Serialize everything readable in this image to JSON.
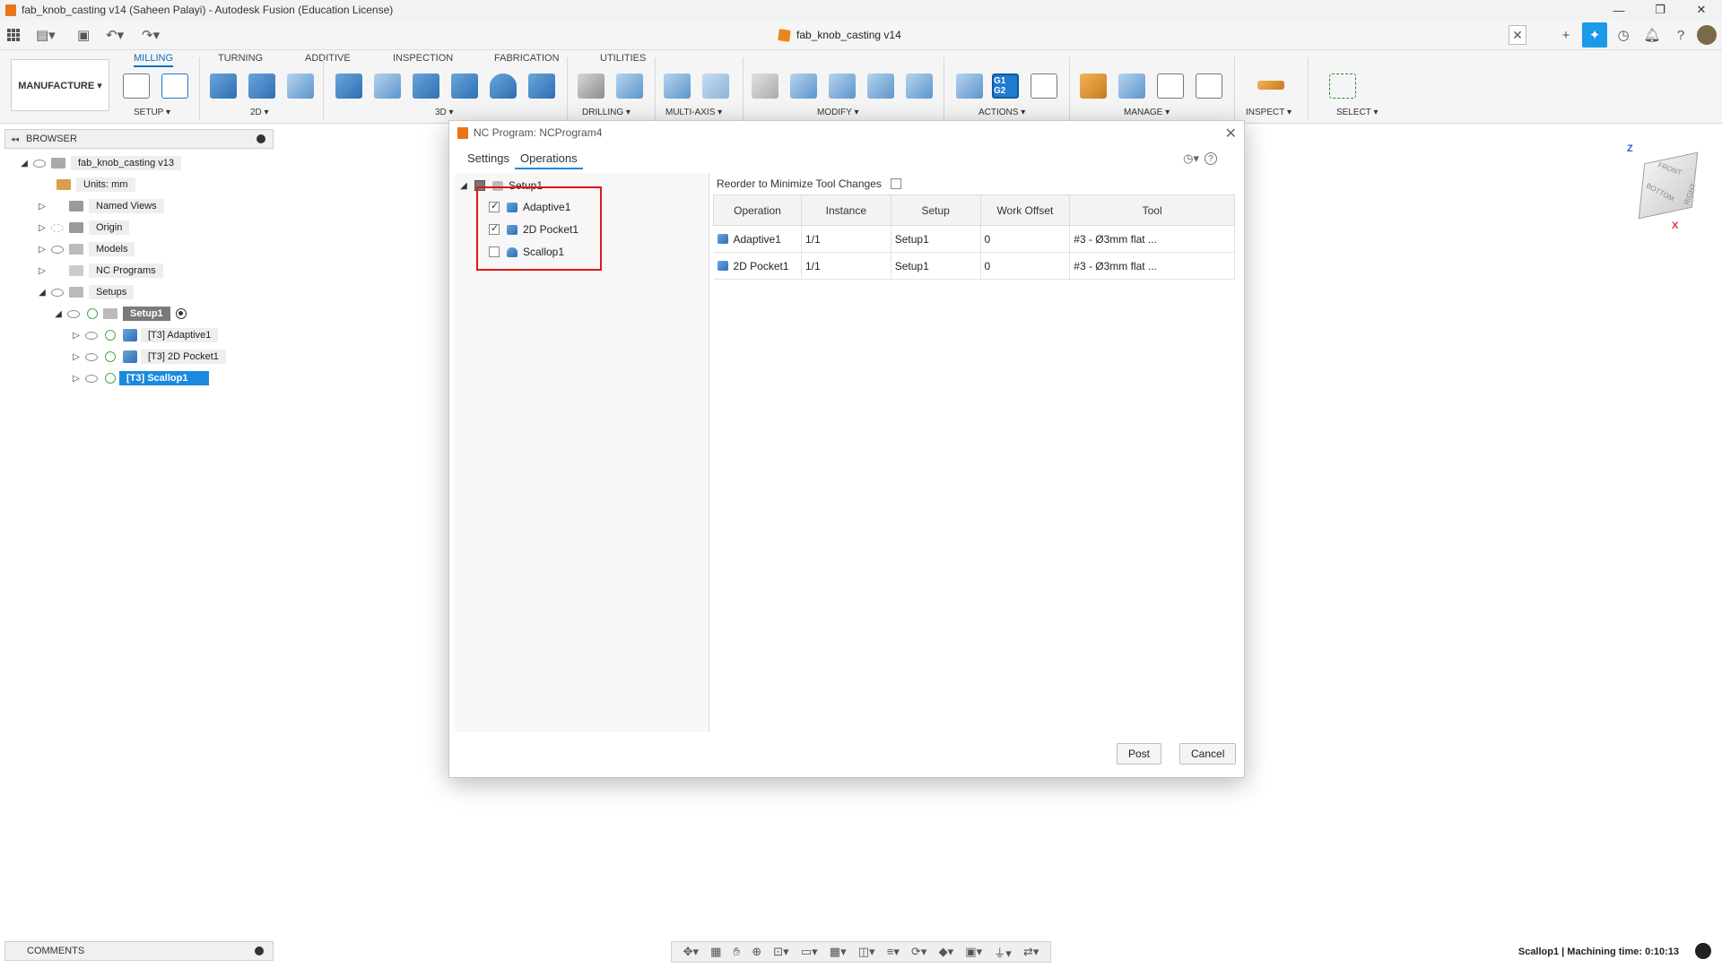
{
  "window": {
    "title": "fab_knob_casting v14 (Saheen Palayi) - Autodesk Fusion (Education License)",
    "minimize": "—",
    "restore": "❐",
    "close": "✕"
  },
  "document_tab": {
    "label": "fab_knob_casting v14",
    "close": "✕"
  },
  "workspace": {
    "label": "MANUFACTURE ▾"
  },
  "ribbon": {
    "tabs": [
      "MILLING",
      "TURNING",
      "ADDITIVE",
      "INSPECTION",
      "FABRICATION",
      "UTILITIES"
    ],
    "groups": [
      "SETUP ▾",
      "2D ▾",
      "3D ▾",
      "DRILLING ▾",
      "MULTI-AXIS ▾",
      "MODIFY ▾",
      "ACTIONS ▾",
      "MANAGE ▾",
      "INSPECT ▾",
      "SELECT ▾"
    ],
    "g1g2": "G1 G2"
  },
  "browser": {
    "header": "BROWSER",
    "root": "fab_knob_casting v13",
    "units": "Units: mm",
    "items": [
      "Named Views",
      "Origin",
      "Models",
      "NC Programs",
      "Setups"
    ],
    "setup": "Setup1",
    "operations": [
      "[T3] Adaptive1",
      "[T3] 2D Pocket1",
      "[T3] Scallop1"
    ]
  },
  "dialog": {
    "title": "NC Program: NCProgram4",
    "tabs": [
      "Settings",
      "Operations"
    ],
    "tree": {
      "setup": "Setup1",
      "ops": [
        {
          "label": "Adaptive1",
          "checked": true
        },
        {
          "label": "2D Pocket1",
          "checked": true
        },
        {
          "label": "Scallop1",
          "checked": false
        }
      ]
    },
    "reorder_label": "Reorder to Minimize Tool Changes",
    "table": {
      "headers": [
        "Operation",
        "Instance",
        "Setup",
        "Work Offset",
        "Tool"
      ],
      "rows": [
        {
          "operation": "Adaptive1",
          "instance": "1/1",
          "setup": "Setup1",
          "work_offset": "0",
          "tool": "#3 - Ø3mm flat ..."
        },
        {
          "operation": "2D Pocket1",
          "instance": "1/1",
          "setup": "Setup1",
          "work_offset": "0",
          "tool": "#3 - Ø3mm flat ..."
        }
      ]
    },
    "post_label": "Post",
    "cancel_label": "Cancel"
  },
  "viewcube": {
    "front": "FRONT",
    "bottom": "BOTTOM",
    "right": "RIGHT",
    "z": "Z",
    "x": "X"
  },
  "comments": {
    "label": "COMMENTS"
  },
  "status": {
    "text": "Scallop1 | Machining time: 0:10:13"
  },
  "colors": {
    "accent": "#1a8ae0",
    "highlight": "#e01818",
    "brand_orange": "#e8751a"
  }
}
